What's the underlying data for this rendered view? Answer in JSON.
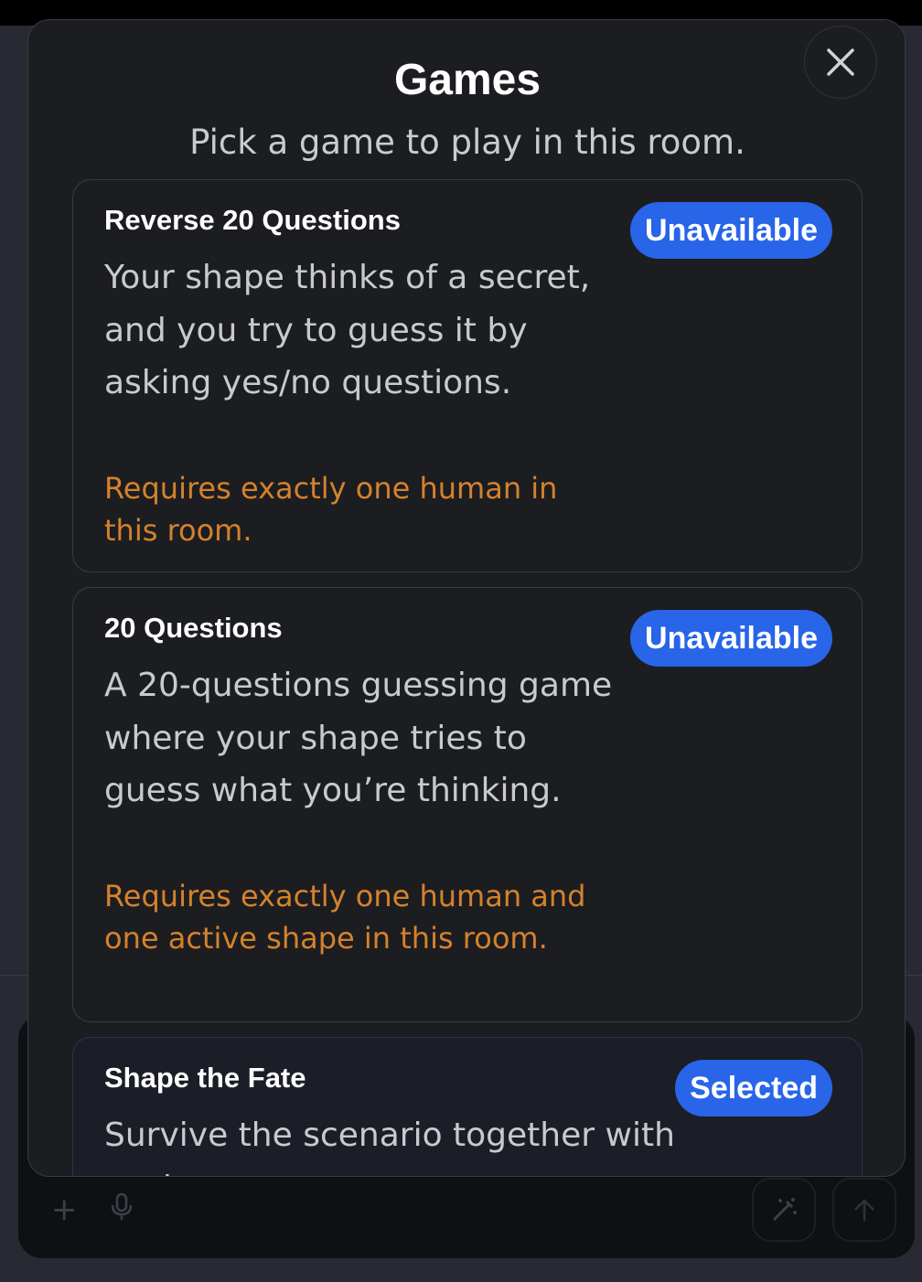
{
  "modal": {
    "title": "Games",
    "subtitle": "Pick a game to play in this room.",
    "close_icon": "close-icon"
  },
  "games": [
    {
      "title": "Reverse 20 Questions",
      "description": "Your shape thinks of a secret, and you try to guess it by asking yes/no questions.",
      "requirement": "Requires exactly one human in this room.",
      "status": "Unavailable"
    },
    {
      "title": "20 Questions",
      "description": "A 20-questions guessing game where your shape tries to guess what you’re thinking.",
      "requirement": "Requires exactly one human and one active shape in this room.",
      "status": "Unavailable"
    },
    {
      "title": "Shape the Fate",
      "description": "Survive the scenario together with each",
      "status": "Selected"
    }
  ],
  "composer": {
    "icons": [
      "plus-icon",
      "microphone-icon",
      "magic-wand-icon",
      "arrow-up-icon"
    ]
  },
  "colors": {
    "accent": "#2865e8",
    "warning": "#d4822c",
    "modal_bg": "#1c1d21"
  }
}
